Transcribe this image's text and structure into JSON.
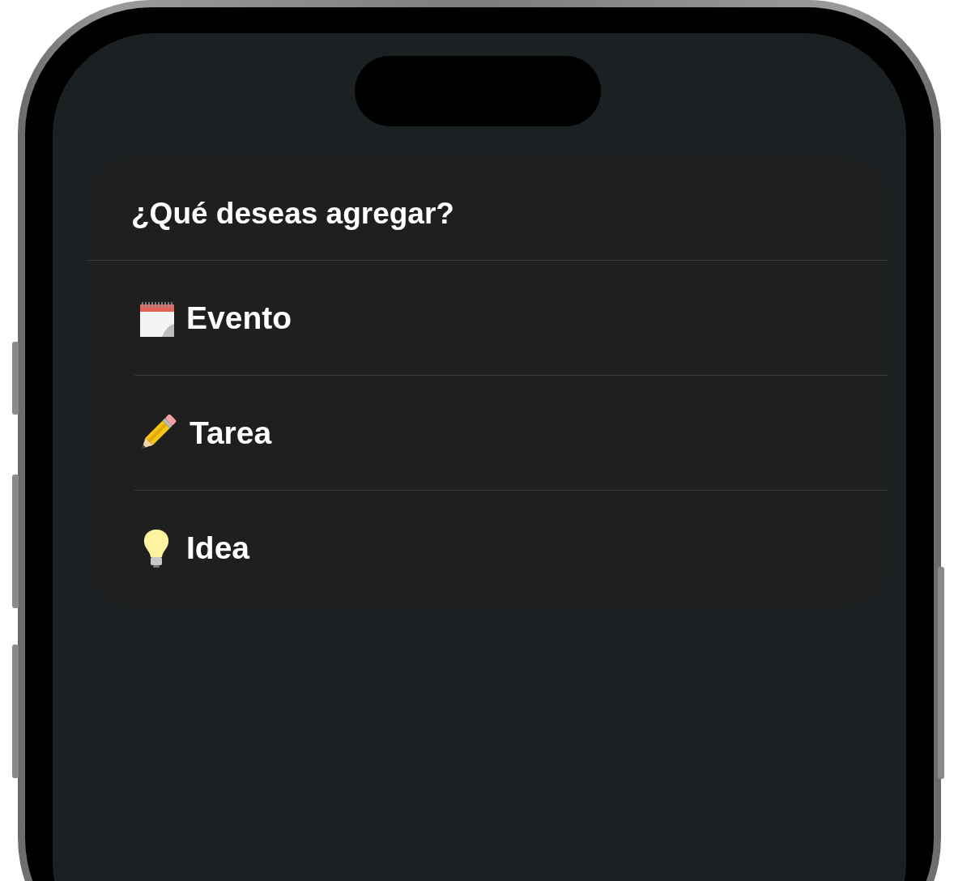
{
  "dialog": {
    "title": "¿Qué deseas agregar?",
    "options": [
      {
        "kind": "calendar",
        "label": "Evento"
      },
      {
        "kind": "pencil",
        "label": "Tarea"
      },
      {
        "kind": "bulb",
        "label": "Idea"
      }
    ]
  }
}
